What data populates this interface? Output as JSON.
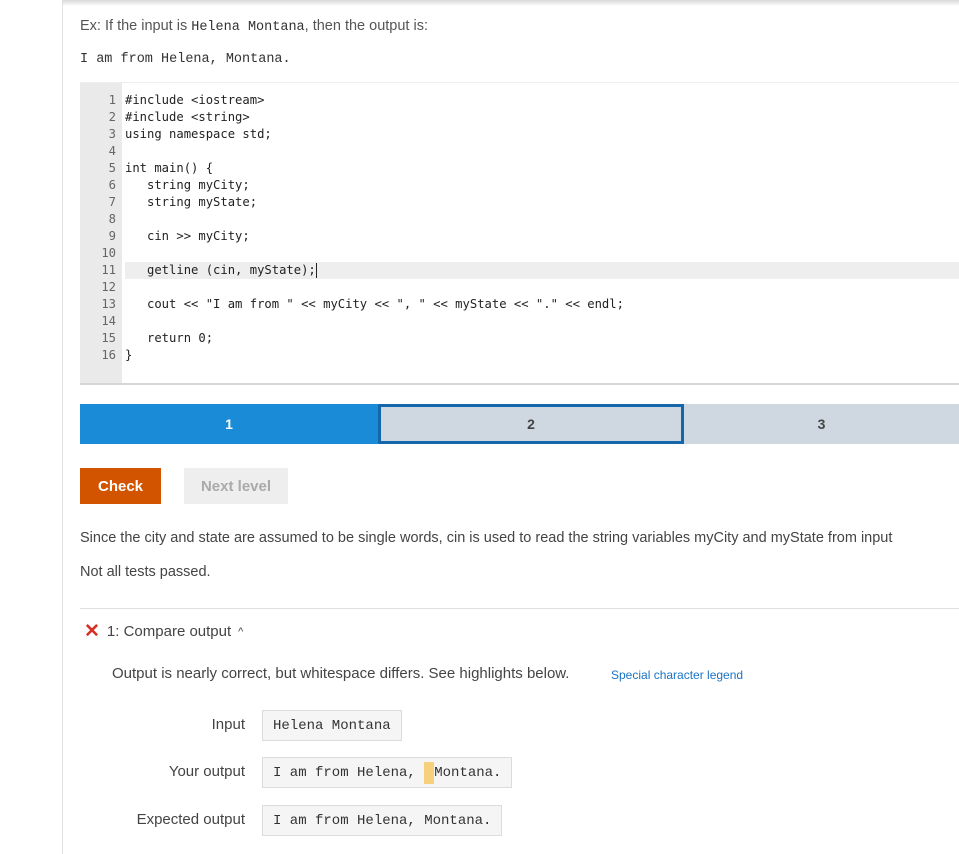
{
  "example": {
    "prefix": "Ex: If the input is ",
    "input": "Helena Montana",
    "suffix": ", then the output is:",
    "output": "I am from Helena, Montana."
  },
  "code": {
    "lines": [
      {
        "n": "1",
        "text": "#include <iostream>"
      },
      {
        "n": "2",
        "text": "#include <string>"
      },
      {
        "n": "3",
        "text": "using namespace std;"
      },
      {
        "n": "4",
        "text": ""
      },
      {
        "n": "5",
        "text": "int main() {"
      },
      {
        "n": "6",
        "text": "   string myCity;"
      },
      {
        "n": "7",
        "text": "   string myState;"
      },
      {
        "n": "8",
        "text": ""
      },
      {
        "n": "9",
        "text": "   cin >> myCity;"
      },
      {
        "n": "10",
        "text": ""
      },
      {
        "n": "11",
        "text": "   getline (cin, myState);"
      },
      {
        "n": "12",
        "text": ""
      },
      {
        "n": "13",
        "text": "   cout << \"I am from \" << myCity << \", \" << myState << \".\" << endl;"
      },
      {
        "n": "14",
        "text": ""
      },
      {
        "n": "15",
        "text": "   return 0;"
      },
      {
        "n": "16",
        "text": "}"
      }
    ]
  },
  "levels": [
    {
      "label": "1",
      "state": "done"
    },
    {
      "label": "2",
      "state": "current"
    },
    {
      "label": "3",
      "state": "todo"
    }
  ],
  "buttons": {
    "check": "Check",
    "next": "Next level"
  },
  "explanation": "Since the city and state are assumed to be single words, cin is used to read the string variables myCity and myState from input",
  "tests_status": "Not all tests passed.",
  "test": {
    "title": "1: Compare output",
    "message": "Output is nearly correct, but whitespace differs. See highlights below.",
    "legend_link": "Special character legend",
    "input_label": "Input",
    "input_value": "Helena Montana",
    "your_output_label": "Your output",
    "your_output_before": "I am from Helena, ",
    "your_output_after": "Montana.",
    "expected_label": "Expected output",
    "expected_value": "I am from Helena, Montana."
  },
  "colors": {
    "done": "#1a8bd6",
    "current_border": "#1567ab",
    "check": "#d35400",
    "fail": "#d93025",
    "highlight": "#f6d07a"
  }
}
